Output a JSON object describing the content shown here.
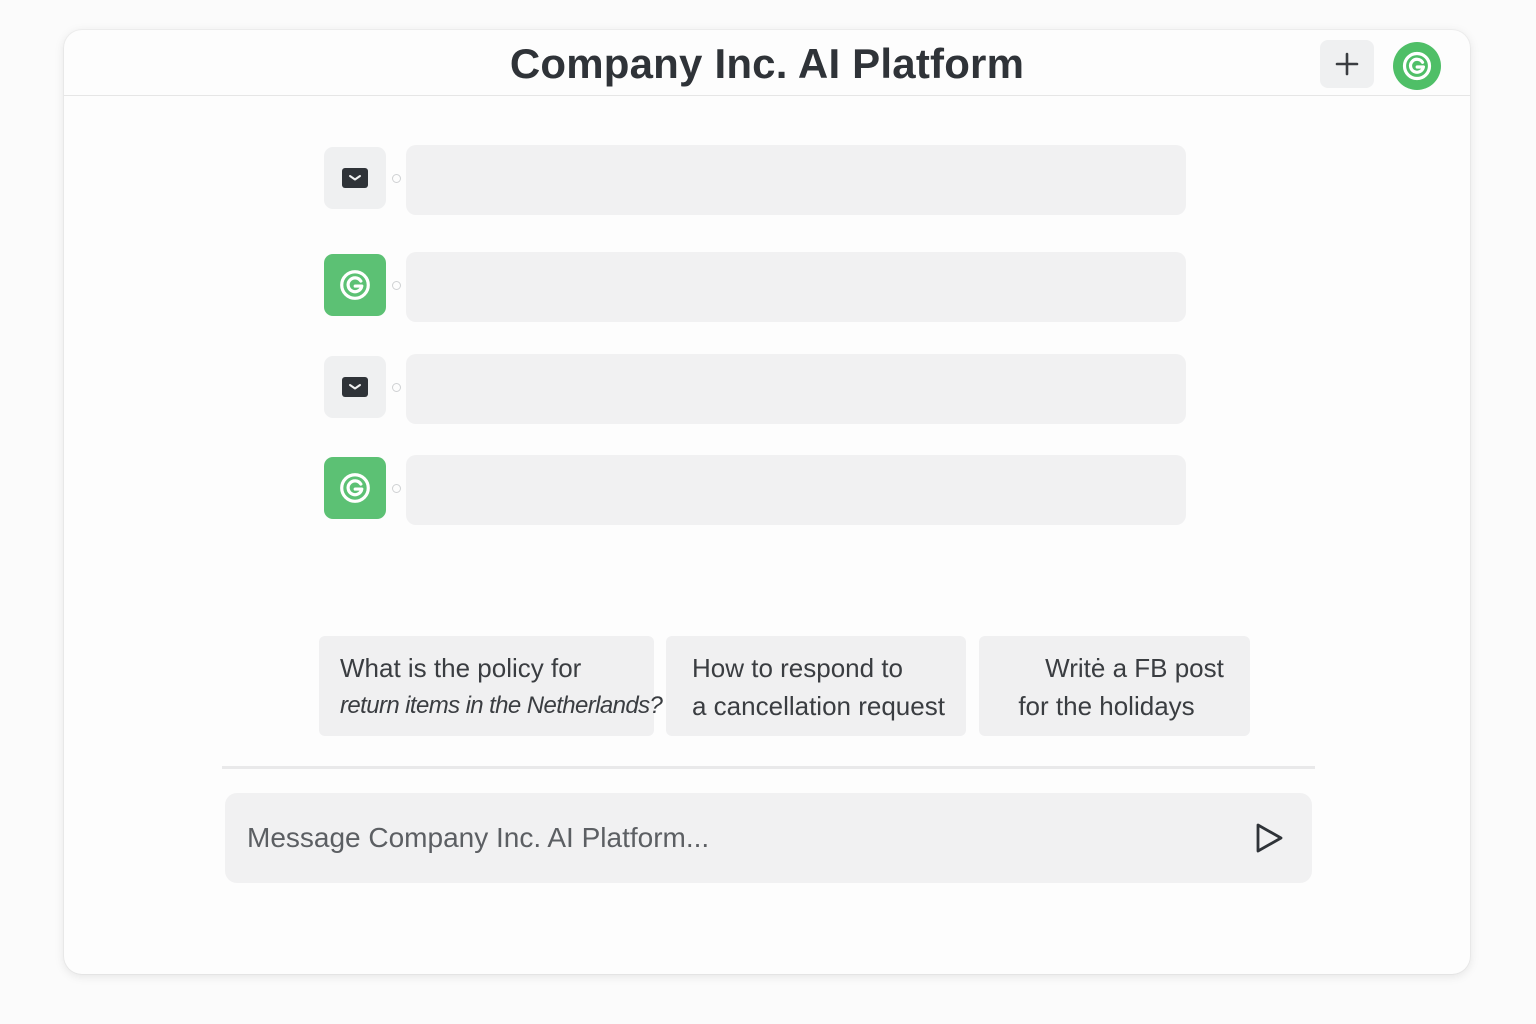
{
  "header": {
    "title": "Company Inc. AI Platform",
    "new_chat_icon": "plus-icon",
    "avatar_icon": "g-logo-icon"
  },
  "conversation": {
    "messages": [
      {
        "role": "user",
        "icon": "message-icon",
        "text": ""
      },
      {
        "role": "assistant",
        "icon": "g-logo-icon",
        "text": ""
      },
      {
        "role": "user",
        "icon": "message-icon",
        "text": ""
      },
      {
        "role": "assistant",
        "icon": "g-logo-icon",
        "text": ""
      }
    ]
  },
  "suggestions": [
    {
      "line1": "What is the policy for",
      "line2": "return items in the Netherlands?"
    },
    {
      "line1": "How to respond to",
      "line2": "a cancellation request"
    },
    {
      "line1": "Writė a FB post",
      "line2": "for the holidays"
    }
  ],
  "composer": {
    "placeholder": "Message Company Inc. AI Platform...",
    "value": "",
    "send_icon": "send-icon"
  },
  "colors": {
    "brand_green": "#4fbf67",
    "bubble_gray": "#f1f1f2",
    "title_text": "#2f3338"
  }
}
